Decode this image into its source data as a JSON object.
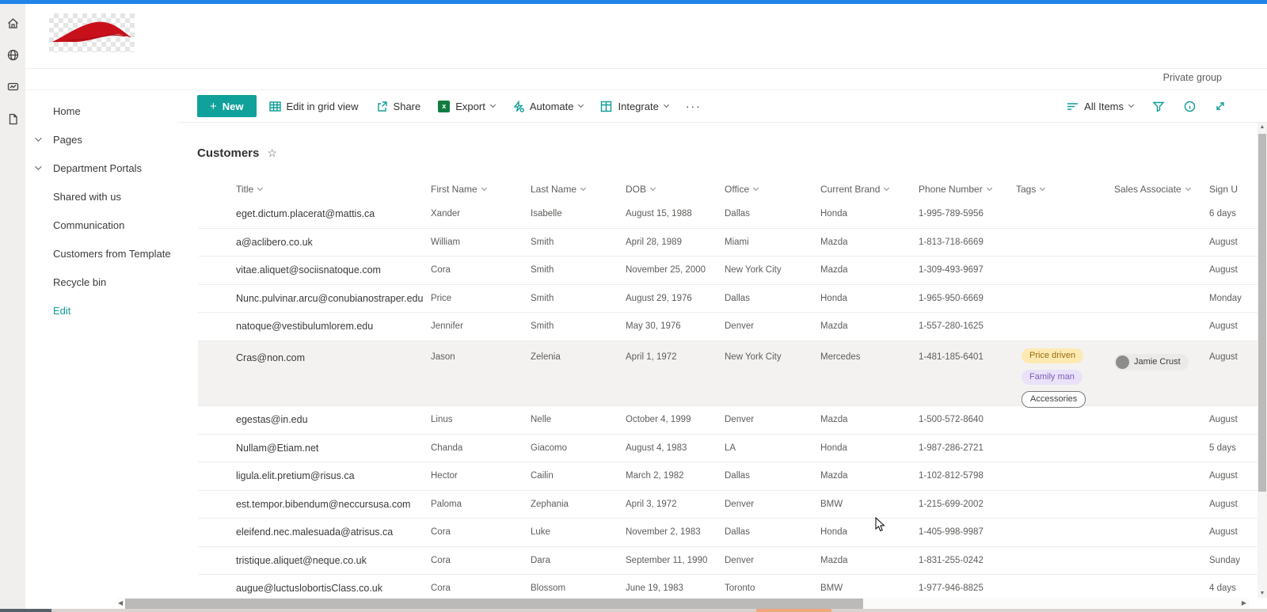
{
  "palette": {
    "topbar_blue": "#2084e8",
    "accent_teal": "#0f9e97",
    "new_button_bg": "#10a19a",
    "excel_green": "#107c41",
    "logo_red": "#c8101b",
    "row_highlight_bg": "#f3f2f1",
    "tag_amber_bg": "#fdeab3",
    "tag_amber_fg": "#9a6a10",
    "tag_purple_bg": "#e9e2f8",
    "tag_purple_fg": "#7e5bb7",
    "tag_outline_border": "#7a7a78"
  },
  "rail": {
    "icons": [
      "home-icon",
      "globe-icon",
      "news-icon",
      "document-icon"
    ]
  },
  "header": {
    "private_group_label": "Private group",
    "logo": "red-car-logo"
  },
  "sidebar": {
    "items": [
      {
        "label": "Home"
      },
      {
        "label": "Pages"
      },
      {
        "label": "Department Portals"
      },
      {
        "label": "Shared with us"
      },
      {
        "label": "Communication"
      },
      {
        "label": "Customers from Template"
      },
      {
        "label": "Recycle bin"
      },
      {
        "label": "Edit"
      }
    ]
  },
  "toolbar": {
    "new_label": "New",
    "edit_grid_label": "Edit in grid view",
    "share_label": "Share",
    "export_label": "Export",
    "excel_glyph": "x",
    "automate_label": "Automate",
    "integrate_label": "Integrate",
    "more_label": "···",
    "view_label": "All Items"
  },
  "list": {
    "title": "Customers",
    "star_glyph": "☆",
    "columns": [
      {
        "label": "Title"
      },
      {
        "label": "First Name"
      },
      {
        "label": "Last Name"
      },
      {
        "label": "DOB"
      },
      {
        "label": "Office"
      },
      {
        "label": "Current Brand"
      },
      {
        "label": "Phone Number"
      },
      {
        "label": "Tags"
      },
      {
        "label": "Sales Associate"
      },
      {
        "label": "Sign U"
      }
    ],
    "rows": [
      {
        "title": "eget.dictum.placerat@mattis.ca",
        "first": "Xander",
        "last": "Isabelle",
        "dob": "August 15, 1988",
        "office": "Dallas",
        "brand": "Honda",
        "phone": "1-995-789-5956",
        "tags": [],
        "associate": "",
        "signup": "6 days"
      },
      {
        "title": "a@aclibero.co.uk",
        "first": "William",
        "last": "Smith",
        "dob": "April 28, 1989",
        "office": "Miami",
        "brand": "Mazda",
        "phone": "1-813-718-6669",
        "tags": [],
        "associate": "",
        "signup": "August"
      },
      {
        "title": "vitae.aliquet@sociisnatoque.com",
        "first": "Cora",
        "last": "Smith",
        "dob": "November 25, 2000",
        "office": "New York City",
        "brand": "Mazda",
        "phone": "1-309-493-9697",
        "tags": [],
        "associate": "",
        "signup": "August"
      },
      {
        "title": "Nunc.pulvinar.arcu@conubianostraper.edu",
        "first": "Price",
        "last": "Smith",
        "dob": "August 29, 1976",
        "office": "Dallas",
        "brand": "Honda",
        "phone": "1-965-950-6669",
        "tags": [],
        "associate": "",
        "signup": "Monday"
      },
      {
        "title": "natoque@vestibulumlorem.edu",
        "first": "Jennifer",
        "last": "Smith",
        "dob": "May 30, 1976",
        "office": "Denver",
        "brand": "Mazda",
        "phone": "1-557-280-1625",
        "tags": [],
        "associate": "",
        "signup": "August"
      },
      {
        "title": "Cras@non.com",
        "first": "Jason",
        "last": "Zelenia",
        "dob": "April 1, 1972",
        "office": "New York City",
        "brand": "Mercedes",
        "phone": "1-481-185-6401",
        "tags": [
          {
            "label": "Price driven",
            "style": "amber"
          },
          {
            "label": "Family man",
            "style": "purple"
          },
          {
            "label": "Accessories",
            "style": "outline"
          }
        ],
        "associate": "Jamie Crust",
        "signup": "August",
        "highlighted": true
      },
      {
        "title": "egestas@in.edu",
        "first": "Linus",
        "last": "Nelle",
        "dob": "October 4, 1999",
        "office": "Denver",
        "brand": "Mazda",
        "phone": "1-500-572-8640",
        "tags": [],
        "associate": "",
        "signup": "August"
      },
      {
        "title": "Nullam@Etiam.net",
        "first": "Chanda",
        "last": "Giacomo",
        "dob": "August 4, 1983",
        "office": "LA",
        "brand": "Honda",
        "phone": "1-987-286-2721",
        "tags": [],
        "associate": "",
        "signup": "5 days"
      },
      {
        "title": "ligula.elit.pretium@risus.ca",
        "first": "Hector",
        "last": "Cailin",
        "dob": "March 2, 1982",
        "office": "Dallas",
        "brand": "Mazda",
        "phone": "1-102-812-5798",
        "tags": [],
        "associate": "",
        "signup": "August"
      },
      {
        "title": "est.tempor.bibendum@neccursusa.com",
        "first": "Paloma",
        "last": "Zephania",
        "dob": "April 3, 1972",
        "office": "Denver",
        "brand": "BMW",
        "phone": "1-215-699-2002",
        "tags": [],
        "associate": "",
        "signup": "August"
      },
      {
        "title": "eleifend.nec.malesuada@atrisus.ca",
        "first": "Cora",
        "last": "Luke",
        "dob": "November 2, 1983",
        "office": "Dallas",
        "brand": "Honda",
        "phone": "1-405-998-9987",
        "tags": [],
        "associate": "",
        "signup": "August"
      },
      {
        "title": "tristique.aliquet@neque.co.uk",
        "first": "Cora",
        "last": "Dara",
        "dob": "September 11, 1990",
        "office": "Denver",
        "brand": "Mazda",
        "phone": "1-831-255-0242",
        "tags": [],
        "associate": "",
        "signup": "Sunday"
      },
      {
        "title": "augue@luctuslobortisClass.co.uk",
        "first": "Cora",
        "last": "Blossom",
        "dob": "June 19, 1983",
        "office": "Toronto",
        "brand": "BMW",
        "phone": "1-977-946-8825",
        "tags": [],
        "associate": "",
        "signup": "4 days"
      }
    ]
  }
}
